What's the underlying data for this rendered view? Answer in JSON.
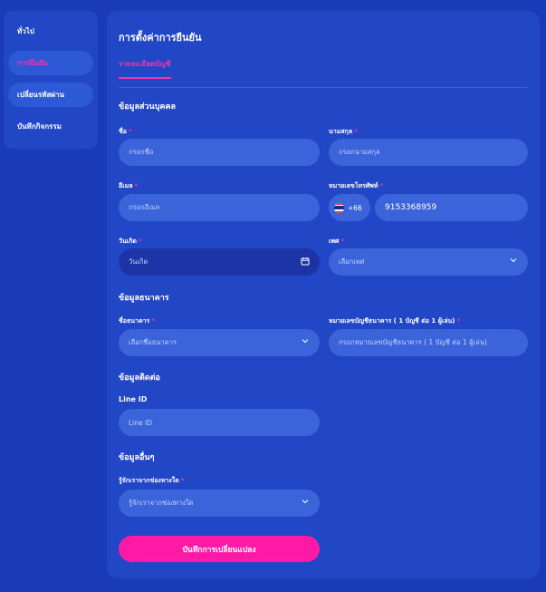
{
  "sidebar": {
    "items": [
      {
        "label": "ทั่วไป"
      },
      {
        "label": "การยืนยัน"
      },
      {
        "label": "เปลี่ยนรหัสผ่าน"
      },
      {
        "label": "บันทึกกิจกรรม"
      }
    ]
  },
  "panel": {
    "title": "การตั้งค่าการยืนยัน",
    "tab": "รายละเอียดบัญชี"
  },
  "personal": {
    "title": "ข้อมูลส่วนบุคคล",
    "first_name_label": "ชื่อ",
    "first_name_placeholder": "กรอกชื่อ",
    "last_name_label": "นามสกุล",
    "last_name_placeholder": "กรอกนามสกุล",
    "email_label": "อีเมล",
    "email_placeholder": "กรอกอีเมล",
    "phone_label": "หมายเลขโทรศัพท์",
    "phone_code": "+66",
    "phone_value": "9153368959",
    "birth_label": "วันเกิด",
    "birth_placeholder": "วันเกิด",
    "gender_label": "เพศ",
    "gender_placeholder": "เลือกเพศ"
  },
  "bank": {
    "title": "ข้อมูลธนาคาร",
    "bank_label": "ชื่อธนาคาร",
    "bank_placeholder": "เลือกชื่อธนาคาร",
    "account_label": "หมายเลขบัญชีธนาคาร ( 1 บัญชี ต่อ 1 ผู้เล่น)",
    "account_placeholder": "กรอกหมายเลขบัญชีธนาคาร ( 1 บัญชี ต่อ 1 ผู้เล่น)"
  },
  "contact": {
    "title": "ข้อมูลติดต่อ",
    "line_label": "Line ID",
    "line_placeholder": "Line ID"
  },
  "other": {
    "title": "ข้อมูลอื่นๆ",
    "source_label": "รู้จักเราจากช่องทางใด",
    "source_placeholder": "รู้จักเราจากช่องทางใด"
  },
  "save_label": "บันทึกการเปลี่ยนแปลง",
  "colors": {
    "background": "#1a3bb8",
    "panel": "#2247c6",
    "accent": "#ff2fa8",
    "input": "#3b64db"
  }
}
